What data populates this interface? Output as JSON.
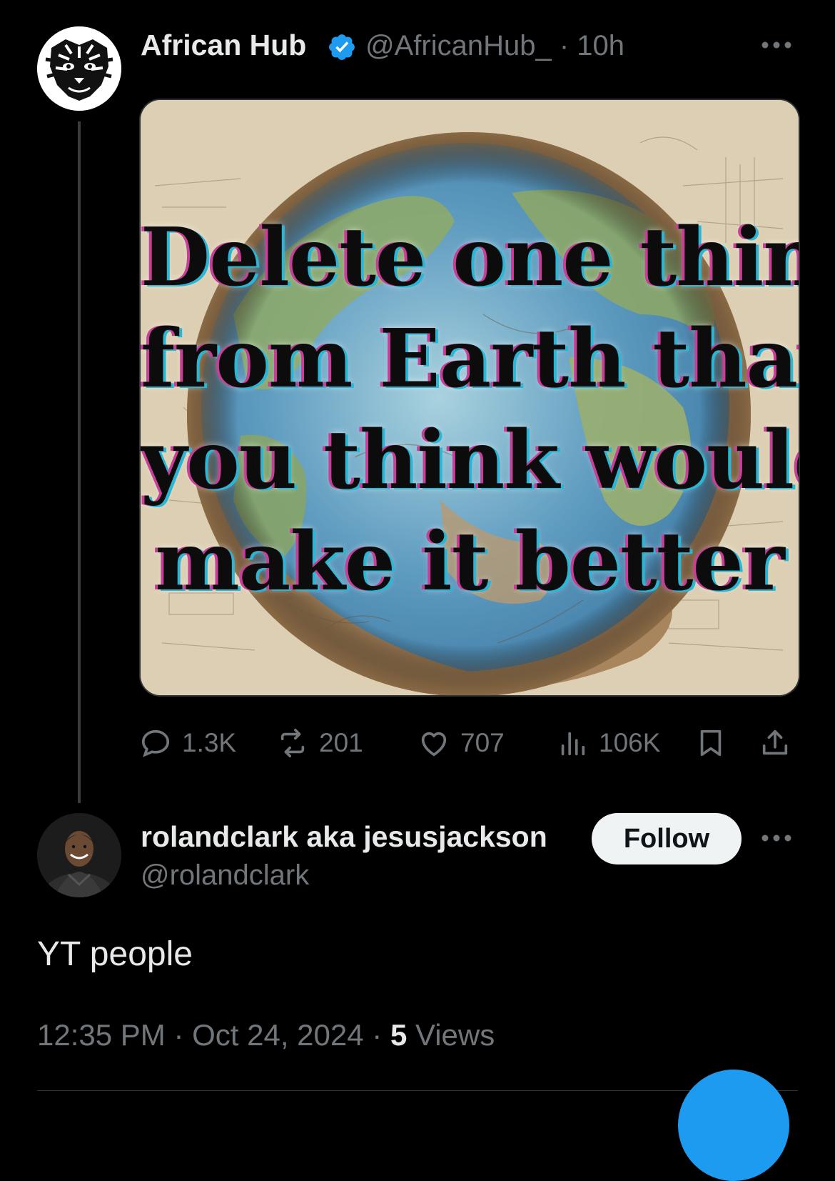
{
  "tweet": {
    "author_name": "African Hub",
    "author_handle": "@AfricanHub_",
    "time_ago": "· 10h",
    "image_text": [
      "Delete one thing",
      "from Earth that",
      "you think would",
      "make it better"
    ],
    "stats": {
      "replies": "1.3K",
      "reposts": "201",
      "likes": "707",
      "views": "106K"
    }
  },
  "reply": {
    "author_name": "rolandclark aka jesusjackson",
    "author_handle": "@rolandclark",
    "follow_label": "Follow",
    "text": "YT people",
    "time": "12:35 PM",
    "date": "Oct 24, 2024",
    "views_count": "5",
    "views_label": "Views"
  },
  "colors": {
    "background": "#000000",
    "primary_text": "#e7e9ea",
    "secondary_text": "#71767b",
    "verified_badge": "#1d9bf0",
    "follow_button_bg": "#eff3f4"
  },
  "icons": [
    "reply-icon",
    "repost-icon",
    "like-icon",
    "views-icon",
    "bookmark-icon",
    "share-icon",
    "verified-badge-icon",
    "more-options-icon"
  ]
}
